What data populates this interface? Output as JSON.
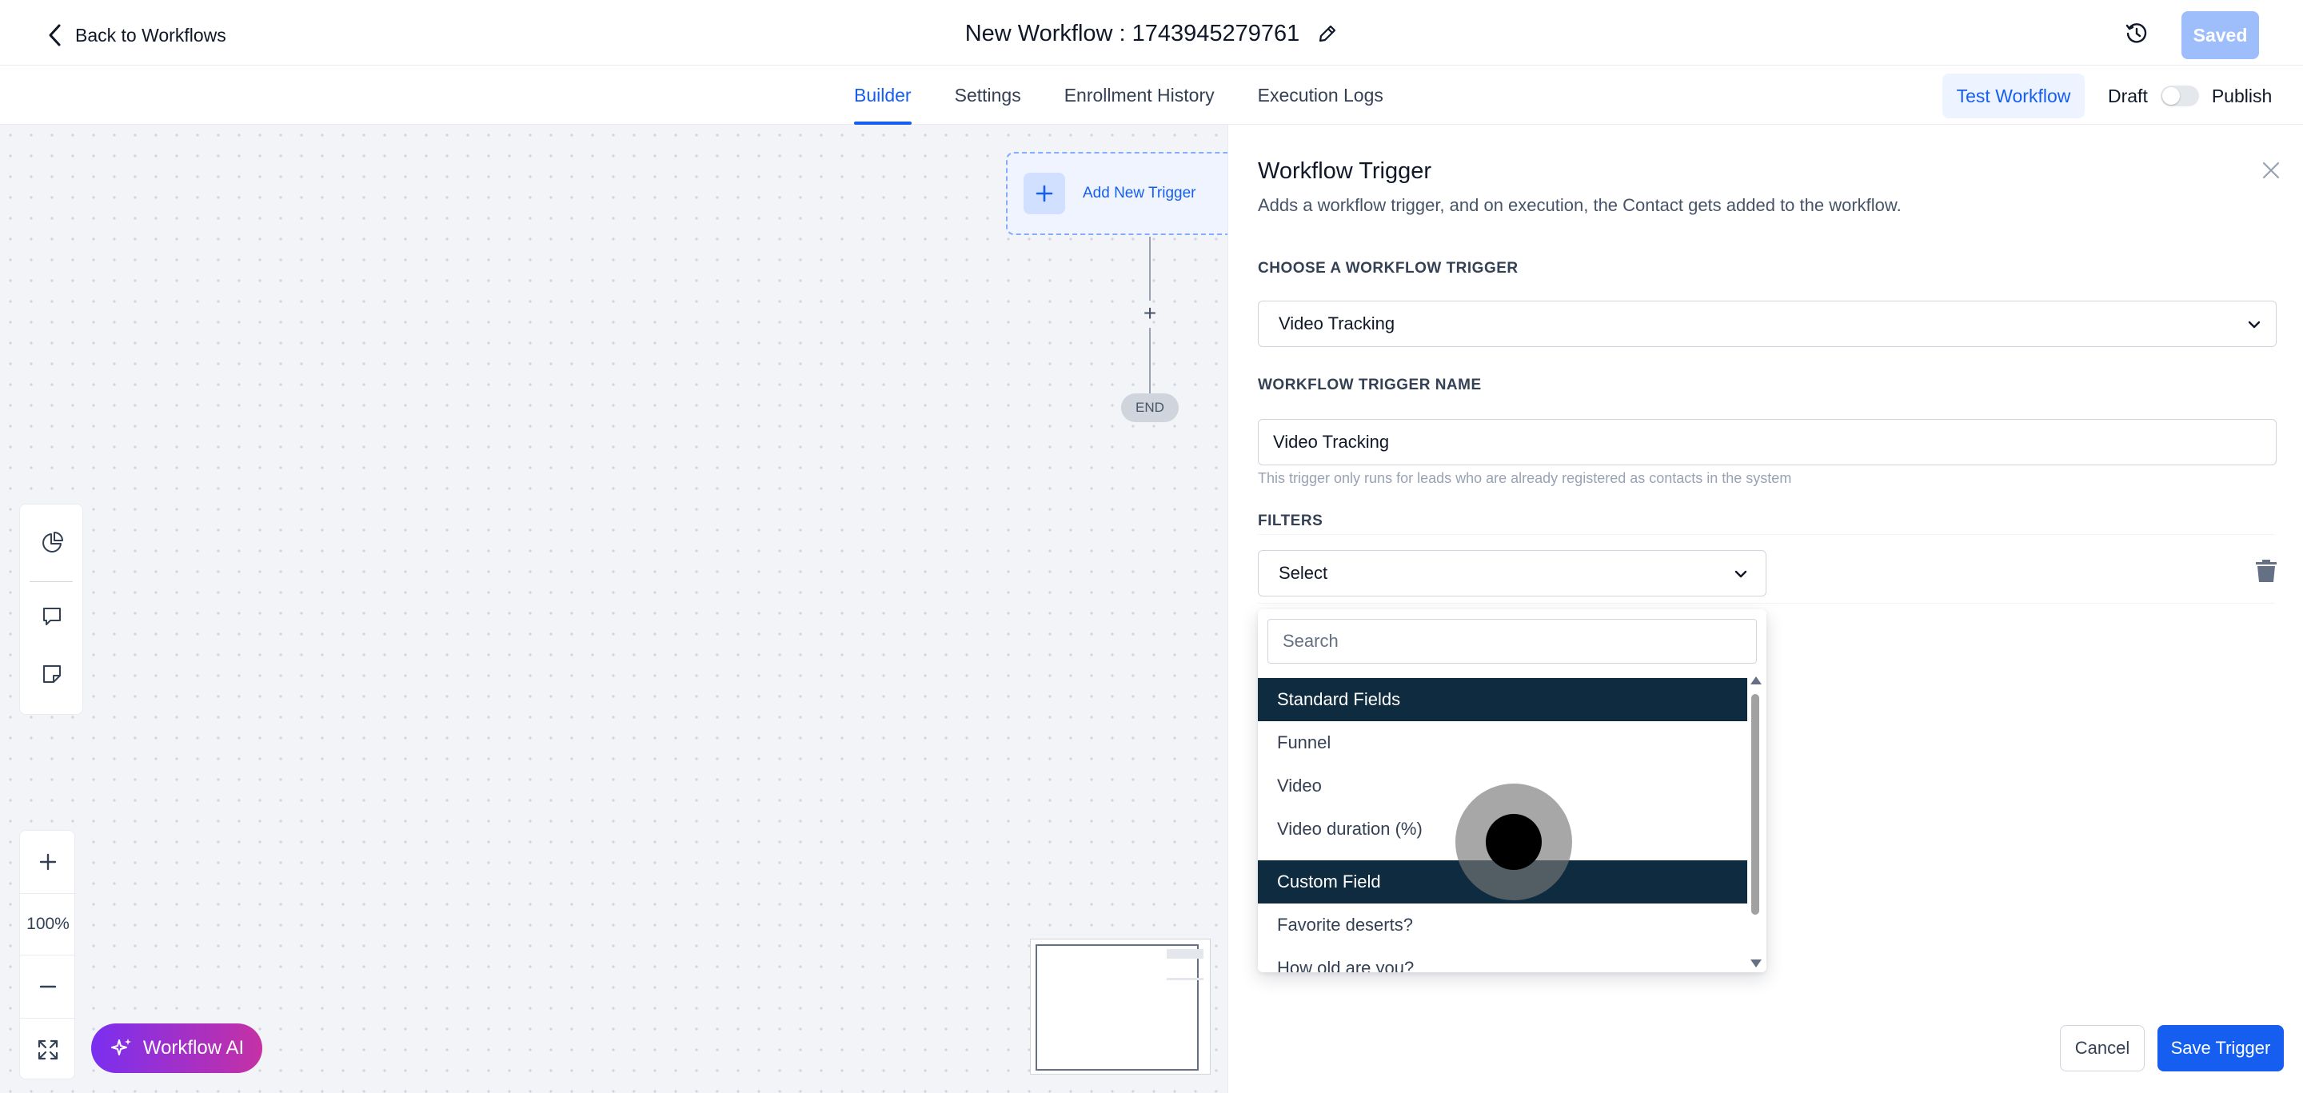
{
  "header": {
    "back_label": "Back to Workflows",
    "workflow_title": "New Workflow : 1743945279761",
    "saved_label": "Saved"
  },
  "tabs": [
    {
      "label": "Builder",
      "active": true
    },
    {
      "label": "Settings",
      "active": false
    },
    {
      "label": "Enrollment History",
      "active": false
    },
    {
      "label": "Execution Logs",
      "active": false
    }
  ],
  "actions": {
    "test_label": "Test Workflow",
    "draft_label": "Draft",
    "publish_label": "Publish",
    "publish_toggle_on": false
  },
  "canvas": {
    "add_trigger_label": "Add New Trigger",
    "add_step_symbol": "+",
    "end_label": "END",
    "zoom_in": "+",
    "zoom_level": "100%",
    "zoom_out": "−",
    "ai_label": "Workflow AI"
  },
  "panel": {
    "title": "Workflow Trigger",
    "subtitle": "Adds a workflow trigger, and on execution, the Contact gets added to the workflow.",
    "choose_label": "CHOOSE A WORKFLOW TRIGGER",
    "trigger_value": "Video Tracking",
    "name_label": "WORKFLOW TRIGGER NAME",
    "name_value": "Video Tracking",
    "help_text": "This trigger only runs for leads who are already registered as contacts in the system",
    "filters_label": "FILTERS",
    "filter_select_value": "Select",
    "search_placeholder": "Search",
    "groups": [
      {
        "label": "Standard Fields",
        "items": [
          "Funnel",
          "Video",
          "Video duration (%)"
        ]
      },
      {
        "label": "Custom Field",
        "items": [
          "Favorite deserts?",
          "How old are you?"
        ]
      }
    ],
    "cancel_label": "Cancel",
    "save_label": "Save Trigger"
  },
  "colors": {
    "primary": "#155eef",
    "group_header": "#0f2b3f",
    "saved_disabled": "#9dbdfb",
    "ai_gradient_start": "#7a2ff0",
    "ai_gradient_end": "#c531a4"
  },
  "icons": [
    "chevron-left-icon",
    "pencil-icon",
    "history-icon",
    "plus-icon",
    "pie-chart-icon",
    "comment-icon",
    "sticky-note-icon",
    "expand-icon",
    "sparkle-icon",
    "close-icon",
    "chevron-down-icon",
    "trash-icon"
  ]
}
